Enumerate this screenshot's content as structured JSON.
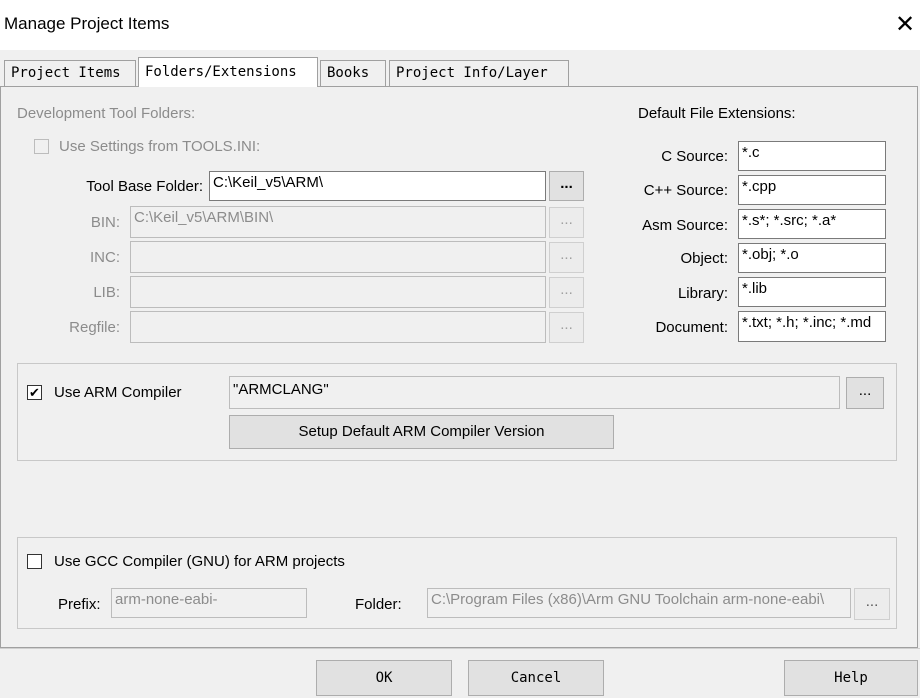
{
  "window": {
    "title": "Manage Project Items",
    "close_glyph": "✕"
  },
  "tabs": [
    {
      "label": "Project Items",
      "active": false
    },
    {
      "label": "Folders/Extensions",
      "active": true
    },
    {
      "label": "Books",
      "active": false
    },
    {
      "label": "Project Info/Layer",
      "active": false
    }
  ],
  "dev_tools": {
    "heading": "Development Tool Folders:",
    "use_tools_ini": {
      "label": "Use Settings from TOOLS.INI:",
      "checked": false,
      "enabled": false
    },
    "tool_base": {
      "label": "Tool Base Folder:",
      "value": "C:\\Keil_v5\\ARM\\",
      "browse": "..."
    },
    "bin": {
      "label": "BIN:",
      "value": "C:\\Keil_v5\\ARM\\BIN\\",
      "browse": "..."
    },
    "inc": {
      "label": "INC:",
      "value": "",
      "browse": "..."
    },
    "lib": {
      "label": "LIB:",
      "value": "",
      "browse": "..."
    },
    "regfile": {
      "label": "Regfile:",
      "value": "",
      "browse": "..."
    }
  },
  "extensions": {
    "heading": "Default File Extensions:",
    "c_source": {
      "label": "C Source:",
      "value": "*.c"
    },
    "cpp_source": {
      "label": "C++ Source:",
      "value": "*.cpp"
    },
    "asm_source": {
      "label": "Asm Source:",
      "value": "*.s*; *.src; *.a*"
    },
    "object": {
      "label": "Object:",
      "value": "*.obj; *.o"
    },
    "library": {
      "label": "Library:",
      "value": "*.lib"
    },
    "document": {
      "label": "Document:",
      "value": "*.txt; *.h; *.inc; *.md"
    }
  },
  "arm_compiler": {
    "checkbox_label": "Use ARM Compiler",
    "checked": true,
    "value": "\"ARMCLANG\"",
    "browse": "...",
    "setup_button": "Setup Default ARM Compiler Version"
  },
  "gcc": {
    "checkbox_label": "Use GCC Compiler (GNU) for ARM projects",
    "checked": false,
    "prefix_label": "Prefix:",
    "prefix_value": "arm-none-eabi-",
    "folder_label": "Folder:",
    "folder_value": "C:\\Program Files (x86)\\Arm GNU Toolchain arm-none-eabi\\",
    "browse": "..."
  },
  "footer": {
    "ok": "OK",
    "cancel": "Cancel",
    "help": "Help"
  },
  "check_glyph": "✔"
}
